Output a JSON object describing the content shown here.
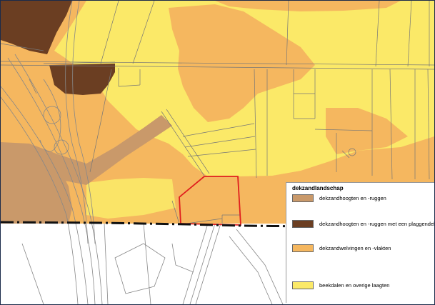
{
  "legend": {
    "title": "dekzandlandschap",
    "items": [
      {
        "label": "dekzandhoogten en -ruggen",
        "color": "#c9996a"
      },
      {
        "label": "dekzandhoogten en -ruggen met een plaggendek",
        "color": "#6b3e22"
      },
      {
        "label": "dekzandwelvingen en -vlakten",
        "color": "#f5b75f"
      },
      {
        "label": "beekdalen en overige laagten",
        "color": "#fbe968"
      }
    ]
  },
  "colors": {
    "plan_boundary": "#e01e1e",
    "border_line": "#111111",
    "roads": "#777777"
  }
}
